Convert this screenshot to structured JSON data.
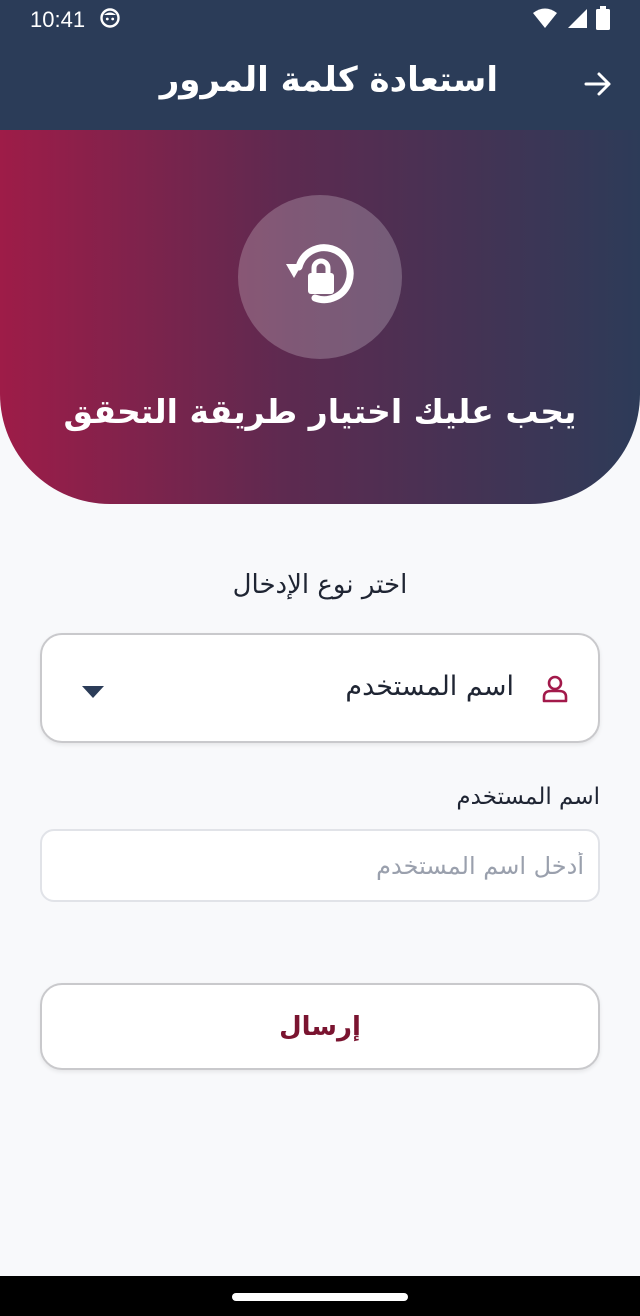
{
  "status_bar": {
    "time": "10:41",
    "icons": [
      "notification-face-icon",
      "wifi-icon",
      "signal-icon",
      "battery-icon"
    ]
  },
  "app_bar": {
    "title": "استعادة كلمة المرور",
    "back_icon": "arrow-right-icon"
  },
  "hero": {
    "icon": "lock-reset-icon",
    "message": "يجب عليك اختيار طريقة التحقق"
  },
  "form": {
    "input_type_label": "اختر نوع الإدخال",
    "input_type": {
      "icon": "user-icon",
      "selected": "اسم المستخدم"
    },
    "username": {
      "label": "اسم المستخدم",
      "value": "",
      "placeholder": "أدخل اسم المستخدم"
    },
    "submit_label": "إرسال"
  },
  "colors": {
    "app_bar": "#2b3c58",
    "hero_start": "#9e1c48",
    "hero_end": "#2d3b58",
    "accent": "#7a1430",
    "background": "#f8f9fb"
  }
}
